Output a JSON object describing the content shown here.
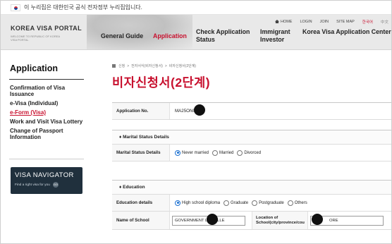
{
  "gov_notice": "이 누리집은 대한민국 공식 전자정부 누리집입니다.",
  "header": {
    "logo_title": "KOREA VISA PORTAL",
    "logo_sub": "WELCOME TO REPUBLIC OF KOREA VISA PORTAL",
    "util": {
      "home": "HOME",
      "login": "LOGIN",
      "join": "JOIN",
      "sitemap": "SITE MAP",
      "lang_ko": "한국어",
      "lang_zh": "中文"
    },
    "nav": {
      "general_guide": "General Guide",
      "application": "Application",
      "check_status": "Check Application Status",
      "immigrant": "Immigrant Investor",
      "center": "Korea Visa Application Center"
    }
  },
  "sidebar": {
    "title": "Application",
    "items": [
      "Confirmation of Visa Issuance",
      "e-Visa (Individual)",
      "e-Form (Visa)",
      "Work and Visit Visa Lottery",
      "Change of Passport Information"
    ],
    "current_index": 2,
    "banner": {
      "title_a": "VISA",
      "title_b": " NAVIGATOR",
      "sub": "Find a right visa for you",
      "go": "GO"
    }
  },
  "main": {
    "breadcrumb": [
      "신청",
      "전자서식(비자신청서)",
      "비자신청서(2단계)"
    ],
    "title": "비자신청서(2단계)",
    "application_no_label": "Application No.",
    "application_no_value": "MA25ON00",
    "marital": {
      "section": "♦ Marital Status Details",
      "label": "Marital Status Details",
      "options": [
        "Never married",
        "Married",
        "Divorced"
      ],
      "selected": 0
    },
    "education": {
      "section": "♦ Education",
      "details_label": "Education details",
      "options": [
        "High school diploma",
        "Graduate",
        "Postgraduate",
        "Others"
      ],
      "selected": 0,
      "school_label": "Name of School",
      "school_value": "GOVERNMENT LA COLLE",
      "location_label": "Location of School(city/province/cou",
      "location_value": "ORE"
    }
  },
  "colors": {
    "accent": "#c8102e",
    "radio_on": "#1a6fd1",
    "banner_bg": "#20303d"
  }
}
